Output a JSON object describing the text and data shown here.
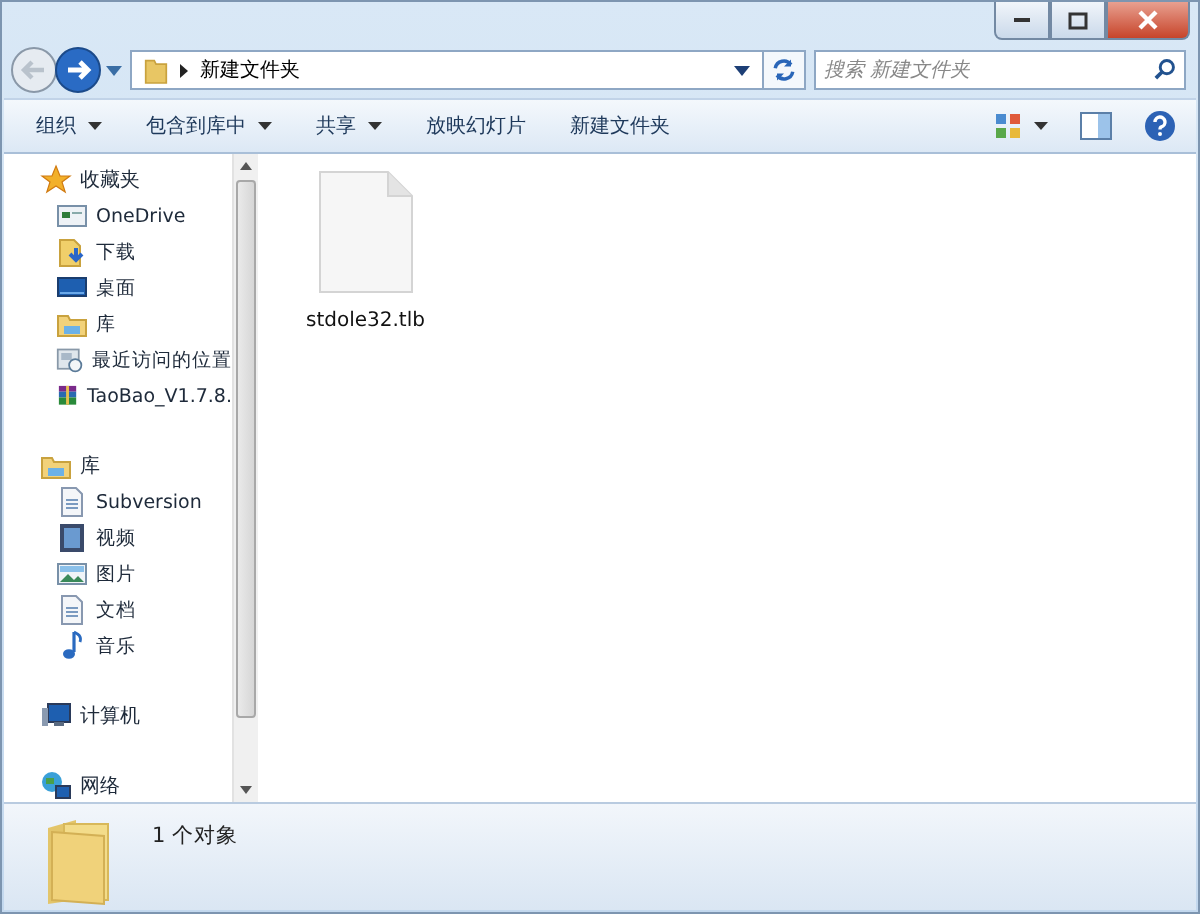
{
  "window": {
    "controls": [
      {
        "kind": "minimize"
      },
      {
        "kind": "maximize"
      },
      {
        "kind": "close"
      }
    ]
  },
  "address": {
    "path": "新建文件夹",
    "search_placeholder": "搜索 新建文件夹"
  },
  "toolbar": [
    {
      "label": "组织",
      "dropdown": true
    },
    {
      "label": "包含到库中",
      "dropdown": true
    },
    {
      "label": "共享",
      "dropdown": true
    },
    {
      "label": "放映幻灯片",
      "dropdown": false
    },
    {
      "label": "新建文件夹",
      "dropdown": false
    }
  ],
  "sidebar": {
    "groups": [
      {
        "label": "收藏夹",
        "kind": "favorites",
        "children": [
          {
            "label": "OneDrive",
            "kind": "cloud"
          },
          {
            "label": "下载",
            "kind": "download"
          },
          {
            "label": "桌面",
            "kind": "desktop"
          },
          {
            "label": "库",
            "kind": "library"
          },
          {
            "label": "最近访问的位置",
            "kind": "recent"
          },
          {
            "label": "TaoBao_V1.7.8.",
            "kind": "archive"
          }
        ]
      },
      {
        "label": "库",
        "kind": "library",
        "children": [
          {
            "label": "Subversion",
            "kind": "document"
          },
          {
            "label": "视频",
            "kind": "video"
          },
          {
            "label": "图片",
            "kind": "image"
          },
          {
            "label": "文档",
            "kind": "document"
          },
          {
            "label": "音乐",
            "kind": "music"
          }
        ]
      },
      {
        "label": "计算机",
        "kind": "computer"
      },
      {
        "label": "网络",
        "kind": "network"
      }
    ]
  },
  "files": [
    {
      "name": "stdole32.tlb",
      "selected": false
    }
  ],
  "status_bar": {
    "count": "1 个对象"
  }
}
